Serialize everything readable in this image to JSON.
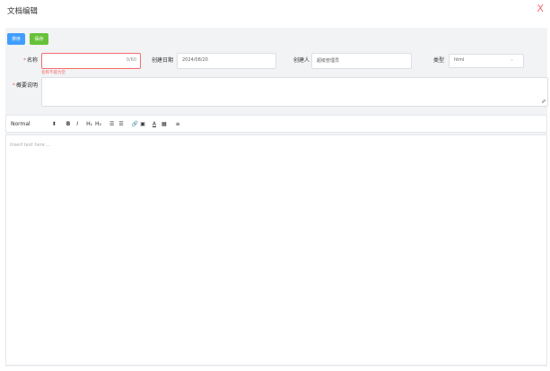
{
  "dialog": {
    "title": "文档编辑",
    "close_label": "X"
  },
  "actions": {
    "sort_label": "排序",
    "save_label": "保存"
  },
  "form": {
    "name": {
      "label": "名称",
      "value": "",
      "counter": "0/60",
      "error": "名称不能为空"
    },
    "created_date": {
      "label": "创建日期",
      "value": "2024/08/20"
    },
    "creator": {
      "label": "创建人",
      "value": "超级管理员"
    },
    "type": {
      "label": "类型",
      "value": "html"
    },
    "summary": {
      "label": "概要说明",
      "value": ""
    }
  },
  "toolbar": {
    "format": "Normal",
    "bold": "B",
    "italic": "I",
    "h1": "H₁",
    "h2": "H₂",
    "ordered_list": "☰",
    "bullet_list": "☰",
    "link": "🔗",
    "image": "▣",
    "text_color": "A",
    "background": "▦",
    "align": "≡"
  },
  "editor": {
    "placeholder": "Insert text here ..."
  },
  "colors": {
    "primary": "#409eff",
    "success": "#67c23a",
    "danger": "#f56c6c"
  }
}
